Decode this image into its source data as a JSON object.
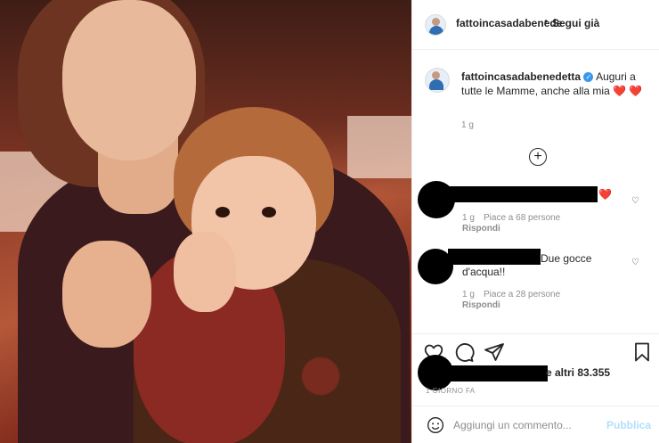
{
  "header": {
    "username": "fattoincasadabenede",
    "separator": "•",
    "follow_label": "Segui già"
  },
  "caption": {
    "username": "fattoincasadabenedetta",
    "text": "Auguri a tutte le Mamme, anche alla mia",
    "time": "1 g"
  },
  "comments": [
    {
      "text": "❤️",
      "time": "1 g",
      "likes": "Piace a 68 persone",
      "reply": "Rispondi"
    },
    {
      "text": "Due gocce d'acqua!!",
      "time": "1 g",
      "likes": "Piace a 28 persone",
      "reply": "Rispondi"
    }
  ],
  "likes_text": "e altri 83.355",
  "post_time": "1 GIORNO FA",
  "add_comment": {
    "placeholder": "Aggiungi un commento...",
    "publish_label": "Pubblica"
  },
  "icons": [
    "heart-icon",
    "comment-icon",
    "share-icon",
    "bookmark-icon",
    "emoji-icon",
    "plus-circle-icon",
    "verified-icon"
  ],
  "colors": {
    "link_blue": "#b2dffc",
    "verified": "#3897f0",
    "heart_red": "#ed4956"
  }
}
